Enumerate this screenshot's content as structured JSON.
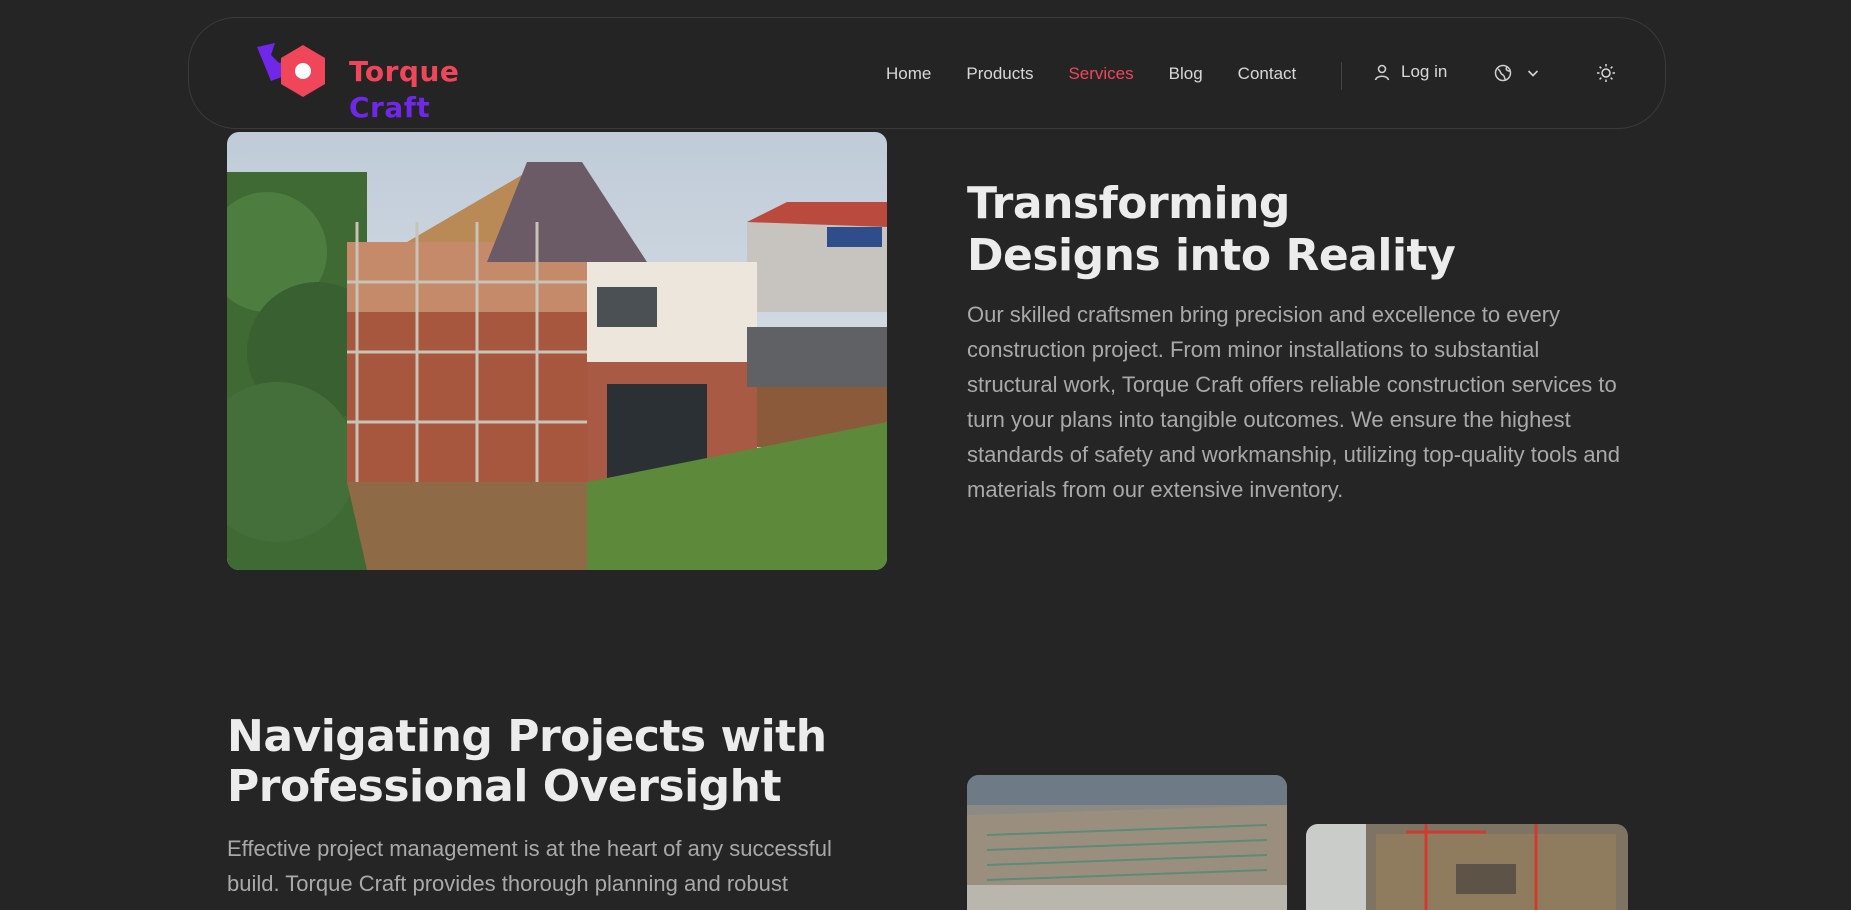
{
  "brand": {
    "line1": "Torque",
    "line2": "Craft",
    "primary": "#f0465a",
    "secondary": "#6f27e8"
  },
  "nav": {
    "items": [
      {
        "label": "Home"
      },
      {
        "label": "Products"
      },
      {
        "label": "Services",
        "active": true
      },
      {
        "label": "Blog"
      },
      {
        "label": "Contact"
      }
    ],
    "login_label": "Log in",
    "icons": {
      "user": "user-icon",
      "language": "globe-icon",
      "dropdown": "chevron-down-icon",
      "theme": "sun-icon"
    }
  },
  "section1": {
    "title_line1": "Transforming",
    "title_line2": "Designs into Reality",
    "text": "Our skilled craftsmen bring precision and excellence to every construction project. From minor installations to substantial structural work, Torque Craft offers reliable construction services to turn your plans into tangible outcomes. We ensure the highest standards of safety and workmanship, utilizing top-quality tools and materials from our extensive inventory."
  },
  "section2": {
    "title_line1": "Navigating Projects with",
    "title_line2": "Professional Oversight",
    "text": "Effective project management is at the heart of any successful build. Torque Craft provides thorough planning and robust"
  }
}
